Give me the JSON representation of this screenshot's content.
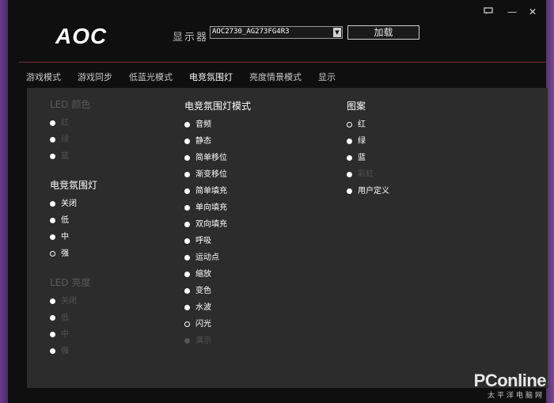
{
  "window": {
    "minimize": "—",
    "close": "✕"
  },
  "app": {
    "logo": "AOC"
  },
  "header": {
    "monitor_label": "显示器",
    "monitor_value": "AOC2730_AG273FG4R3",
    "load_label": "加载"
  },
  "tabs": [
    {
      "label": "游戏模式"
    },
    {
      "label": "游戏同步"
    },
    {
      "label": "低蓝光模式"
    },
    {
      "label": "电竞氛围灯",
      "active": true
    },
    {
      "label": "亮度情景模式"
    },
    {
      "label": "显示"
    }
  ],
  "led_color": {
    "heading": "LED 颜色",
    "options": [
      {
        "label": "红",
        "selected": false
      },
      {
        "label": "绿",
        "selected": false
      },
      {
        "label": "蓝",
        "selected": false
      }
    ]
  },
  "ambient": {
    "heading": "电竞氛围灯",
    "options": [
      {
        "label": "关闭",
        "selected": false
      },
      {
        "label": "低",
        "selected": false
      },
      {
        "label": "中",
        "selected": false
      },
      {
        "label": "强",
        "selected": true
      }
    ]
  },
  "led_brightness": {
    "heading": "LED 亮度",
    "options": [
      {
        "label": "关闭",
        "selected": false
      },
      {
        "label": "低",
        "selected": false
      },
      {
        "label": "中",
        "selected": false
      },
      {
        "label": "强",
        "selected": false
      }
    ]
  },
  "ambient_mode": {
    "heading": "电竞氛围灯模式",
    "options": [
      {
        "label": "音频",
        "selected": false
      },
      {
        "label": "静态",
        "selected": false
      },
      {
        "label": "简单移位",
        "selected": false
      },
      {
        "label": "渐变移位",
        "selected": false
      },
      {
        "label": "简单填充",
        "selected": false
      },
      {
        "label": "单向填充",
        "selected": false
      },
      {
        "label": "双向填充",
        "selected": false
      },
      {
        "label": "呼吸",
        "selected": false
      },
      {
        "label": "运动点",
        "selected": false
      },
      {
        "label": "缩放",
        "selected": false
      },
      {
        "label": "变色",
        "selected": false
      },
      {
        "label": "水波",
        "selected": false
      },
      {
        "label": "闪光",
        "selected": true
      },
      {
        "label": "演示",
        "selected": false,
        "disabled": true
      }
    ]
  },
  "pattern": {
    "heading": "图案",
    "options": [
      {
        "label": "红",
        "selected": true
      },
      {
        "label": "绿",
        "selected": false
      },
      {
        "label": "蓝",
        "selected": false
      },
      {
        "label": "彩虹",
        "selected": false,
        "disabled": true
      },
      {
        "label": "用户定义",
        "selected": false
      }
    ]
  },
  "watermark": {
    "brand": "PConline",
    "sub": "太平洋电脑网"
  },
  "colors": {
    "background": "#0f0f10",
    "panel": "#2c2c2c",
    "divider": "#7a2e2e",
    "text": "#ffffff",
    "disabled": "#555555"
  }
}
